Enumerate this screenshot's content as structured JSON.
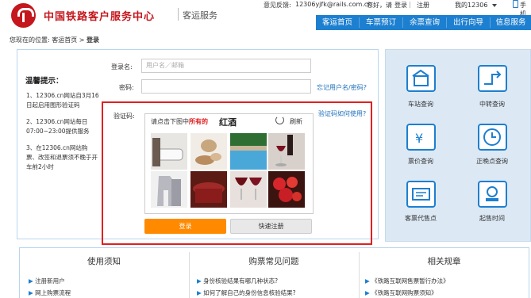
{
  "header": {
    "logo_title": "中国铁路客户服务中心",
    "logo_sub": "客运服务",
    "feedback_label": "意见反馈:",
    "feedback_email": "12306yjfk@rails.com.cn",
    "greeting_pre": "您好，请",
    "login_link": "登录",
    "register_link": "注册",
    "my_account": "我的12306",
    "mobile": "手机"
  },
  "nav": [
    "客运首页",
    "车票预订",
    "余票查询",
    "出行向导",
    "信息服务"
  ],
  "breadcrumb": {
    "prefix": "您现在的位置:",
    "home": "客运首页",
    "sep": ">",
    "current": "登录"
  },
  "tips": {
    "title": "温馨提示：",
    "items": [
      "1、12306.cn网站自3月16日起启用图形验证码",
      "2、12306.cn网站每日07:00~23:00提供服务",
      "3、在12306.cn网站购票、改签和退票须不晚于开车前2小时"
    ]
  },
  "form": {
    "username_label": "登录名:",
    "username_placeholder": "用户名／邮箱",
    "password_label": "密码:",
    "forgot_link": "忘记用户名/密码?",
    "captcha_label": "验证码:",
    "captcha_help": "验证码如何使用?",
    "captcha_prompt_pre": "请点击下图中",
    "captcha_prompt_highlight": "所有的",
    "captcha_word": "红酒",
    "refresh_label": "刷新",
    "login_button": "登录",
    "register_button": "快速注册"
  },
  "services": [
    {
      "label": "车站查询",
      "icon": "station-icon"
    },
    {
      "label": "中转查询",
      "icon": "transfer-icon"
    },
    {
      "label": "票价查询",
      "icon": "fare-icon"
    },
    {
      "label": "正晚点查询",
      "icon": "clock-icon"
    },
    {
      "label": "客票代售点",
      "icon": "ticket-agency-icon"
    },
    {
      "label": "起售时间",
      "icon": "sale-time-icon"
    }
  ],
  "bottom": {
    "cols": [
      {
        "title": "使用须知",
        "items": [
          "注册新用户",
          "网上购票流程"
        ]
      },
      {
        "title": "购票常见问题",
        "items": [
          "身份核验结果有哪几种状态?",
          "如何了解自己的身份信息核验结果?"
        ]
      },
      {
        "title": "相关规章",
        "items": [
          "《铁路互联网售票暂行办法》",
          "《铁路互联网购票须知》"
        ]
      }
    ]
  },
  "colors": {
    "brand_red": "#c4161c",
    "nav_blue": "#1d7fd0",
    "login_orange": "#ff8a00",
    "highlight_red": "#e02020"
  }
}
